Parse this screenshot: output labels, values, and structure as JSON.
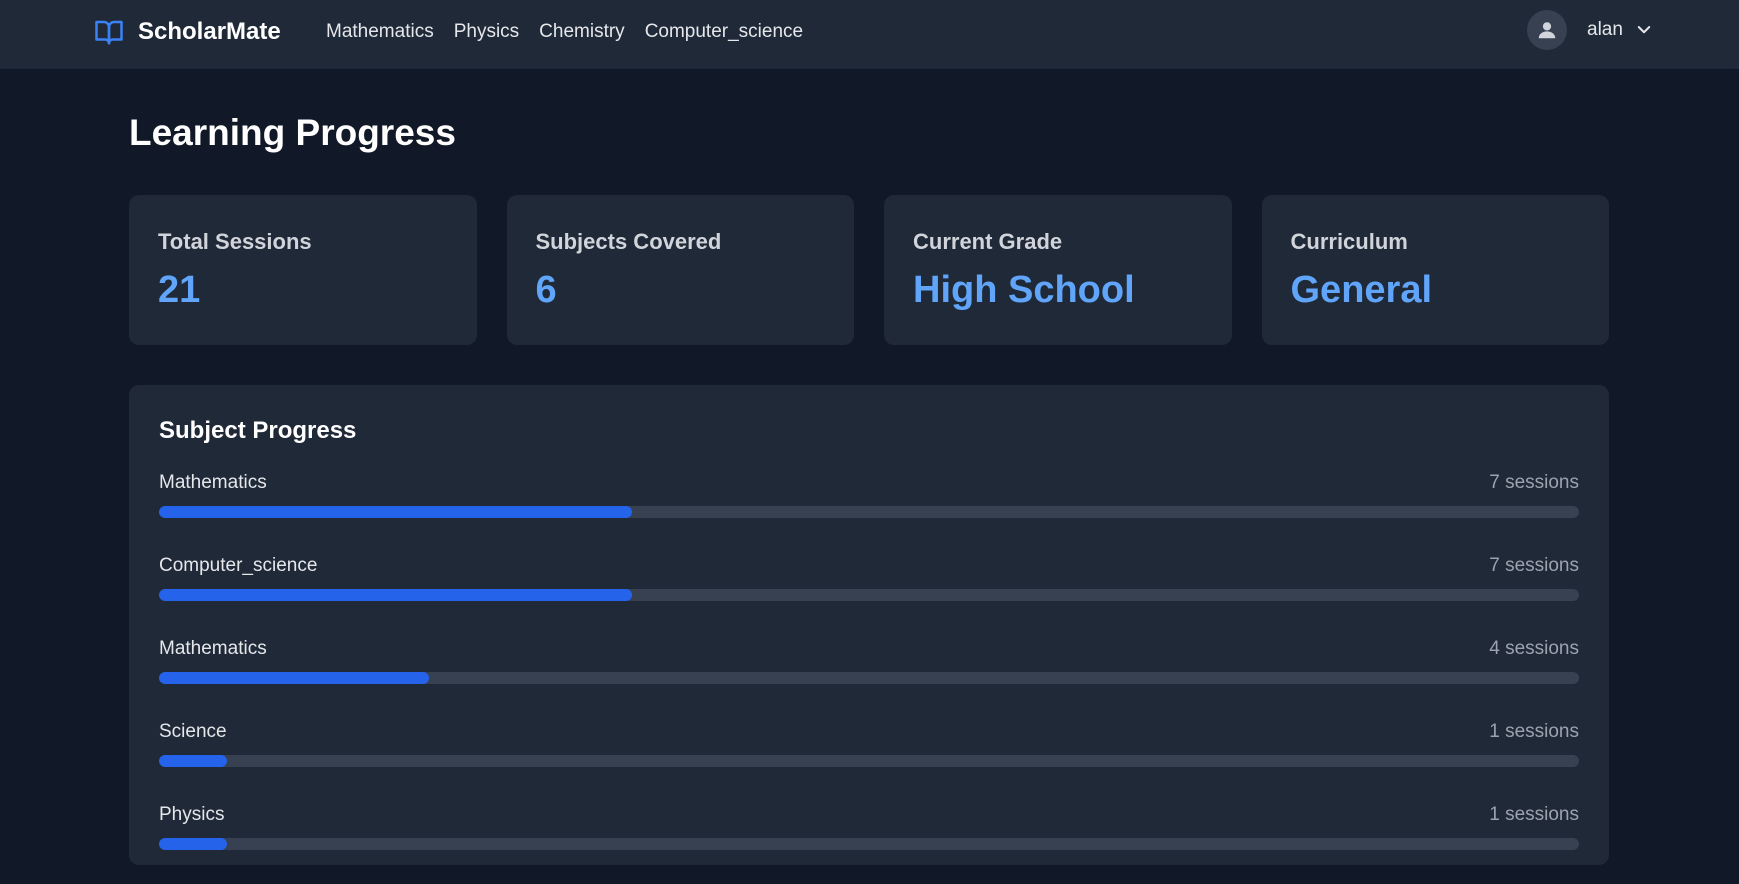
{
  "navbar": {
    "brand": "ScholarMate",
    "links": [
      "Mathematics",
      "Physics",
      "Chemistry",
      "Computer_science"
    ],
    "user": "alan"
  },
  "page": {
    "title": "Learning Progress"
  },
  "stats": [
    {
      "label": "Total Sessions",
      "value": "21"
    },
    {
      "label": "Subjects Covered",
      "value": "6"
    },
    {
      "label": "Current Grade",
      "value": "High School"
    },
    {
      "label": "Curriculum",
      "value": "General"
    }
  ],
  "progress": {
    "title": "Subject Progress",
    "items": [
      {
        "subject": "Mathematics",
        "sessions": "7 sessions",
        "fraction": 0.333
      },
      {
        "subject": "Computer_science",
        "sessions": "7 sessions",
        "fraction": 0.333
      },
      {
        "subject": "Mathematics",
        "sessions": "4 sessions",
        "fraction": 0.19
      },
      {
        "subject": "Science",
        "sessions": "1 sessions",
        "fraction": 0.048
      },
      {
        "subject": "Physics",
        "sessions": "1 sessions",
        "fraction": 0.048
      }
    ]
  },
  "colors": {
    "accent": "#60a5fa",
    "bar": "#2563eb",
    "track": "#374151",
    "card": "#1f2937",
    "background": "#111827"
  }
}
